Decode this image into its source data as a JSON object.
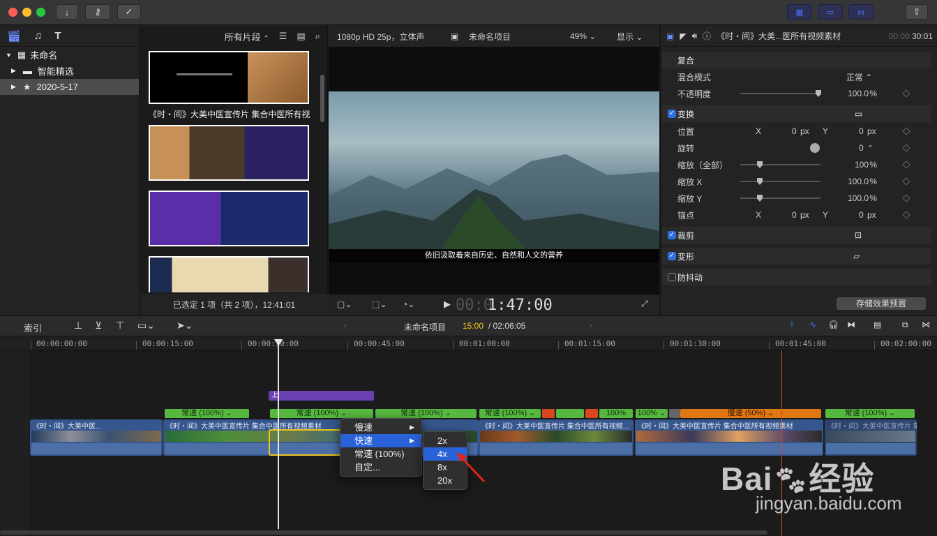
{
  "library": {
    "root": "未命名",
    "items": [
      {
        "label": "智能精选"
      },
      {
        "label": "2020-5-17"
      }
    ]
  },
  "browser": {
    "filter_label": "所有片段",
    "clip_title": "《时・间》大美中医宣传片 集合中医所有视",
    "status": "已选定 1 项（共 2 项），12:41:01"
  },
  "viewer": {
    "format": "1080p HD 25p，立体声",
    "project": "未命名项目",
    "zoom": "49%",
    "display_label": "显示",
    "subtitle": "依旧汲取着来自历史、自然和人文的营养",
    "timecode_dim": "00:0",
    "timecode": "1:47:00"
  },
  "inspector": {
    "clip_name": "《时・间》大美...医所有视频素材",
    "duration_dim": "00:00:",
    "duration": "30:01",
    "composite_header": "复合",
    "blend_label": "混合模式",
    "blend_value": "正常",
    "opacity_label": "不透明度",
    "opacity_value": "100.0",
    "pct": "%",
    "transform_header": "变换",
    "position_label": "位置",
    "x_label": "X",
    "y_label": "Y",
    "px_unit": "px",
    "pos_x": "0",
    "pos_y": "0",
    "rotation_label": "旋转",
    "rotation_value": "0",
    "deg_unit": "°",
    "scale_all_label": "缩放（全部）",
    "scale_all_value": "100",
    "scale_x_label": "缩放 X",
    "scale_x_value": "100.0",
    "scale_y_label": "缩放 Y",
    "scale_y_value": "100.0",
    "anchor_label": "锚点",
    "anchor_x": "0",
    "anchor_y": "0",
    "crop_header": "裁剪",
    "distort_header": "变形",
    "stabilize_header": "防抖动",
    "save_preset": "存储效果预置"
  },
  "timeline": {
    "index_label": "索引",
    "project": "未命名项目",
    "current_time": "15:00",
    "total_time": "/ 02:06:05",
    "ruler": [
      "00:00:00:00",
      "00:00:15:00",
      "00:00:30:00",
      "00:00:45:00",
      "00:01:00:00",
      "00:01:15:00",
      "00:01:30:00",
      "00:01:45:00",
      "00:02:00:00"
    ],
    "title_clip": "上",
    "speeds": {
      "normal": "常速 (100%)",
      "p100": "100%",
      "slow50": "慢速 (50%)"
    },
    "clip_label": "《时・间》大美中医宣传片 集合中医所有视频素材",
    "clip_short": "《时・间》大美中医...",
    "clip_mid": "《时・间》大美中医宣传片 集合中医所有视频...",
    "clip_end": "《时・间》大美中医宣传片 集合中医所有视..."
  },
  "context_menu": {
    "items": [
      {
        "label": "慢速"
      },
      {
        "label": "快速"
      },
      {
        "label": "常速 (100%)"
      },
      {
        "label": "自定..."
      }
    ],
    "submenu": [
      "2x",
      "4x",
      "8x",
      "20x"
    ]
  },
  "watermark": {
    "brand": "Bai",
    "brand_cn": "经验",
    "url": "jingyan.baidu.com"
  },
  "colors": {
    "accent": "#2a62d9",
    "speed_green": "#57b840",
    "speed_orange": "#e07812",
    "playhead_red": "#e0402a",
    "timecode_yellow": "#f0c419"
  }
}
